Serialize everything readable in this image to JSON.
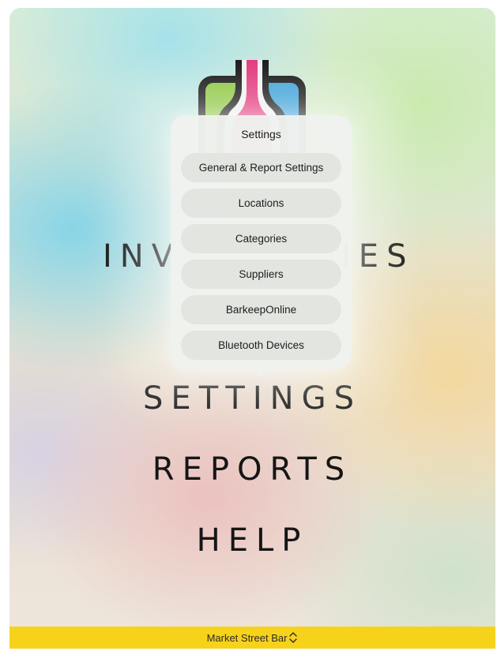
{
  "main_menu": {
    "inventories_left": "INV",
    "inventories_right": "IES",
    "settings": "SETTINGS",
    "reports": "REPORTS",
    "help": "HELP"
  },
  "popover": {
    "title": "Settings",
    "items": [
      {
        "label": "General & Report Settings"
      },
      {
        "label": "Locations"
      },
      {
        "label": "Categories"
      },
      {
        "label": "Suppliers"
      },
      {
        "label": "BarkeepOnline"
      },
      {
        "label": "Bluetooth Devices"
      }
    ]
  },
  "bottom_bar": {
    "location_name": "Market Street Bar",
    "icon": "chevron-up-down-icon"
  },
  "colors": {
    "bottom_bar": "#f7d21a",
    "logo_green": "#8cc63f",
    "logo_blue": "#3aa0d8",
    "logo_pink": "#e2357a"
  }
}
